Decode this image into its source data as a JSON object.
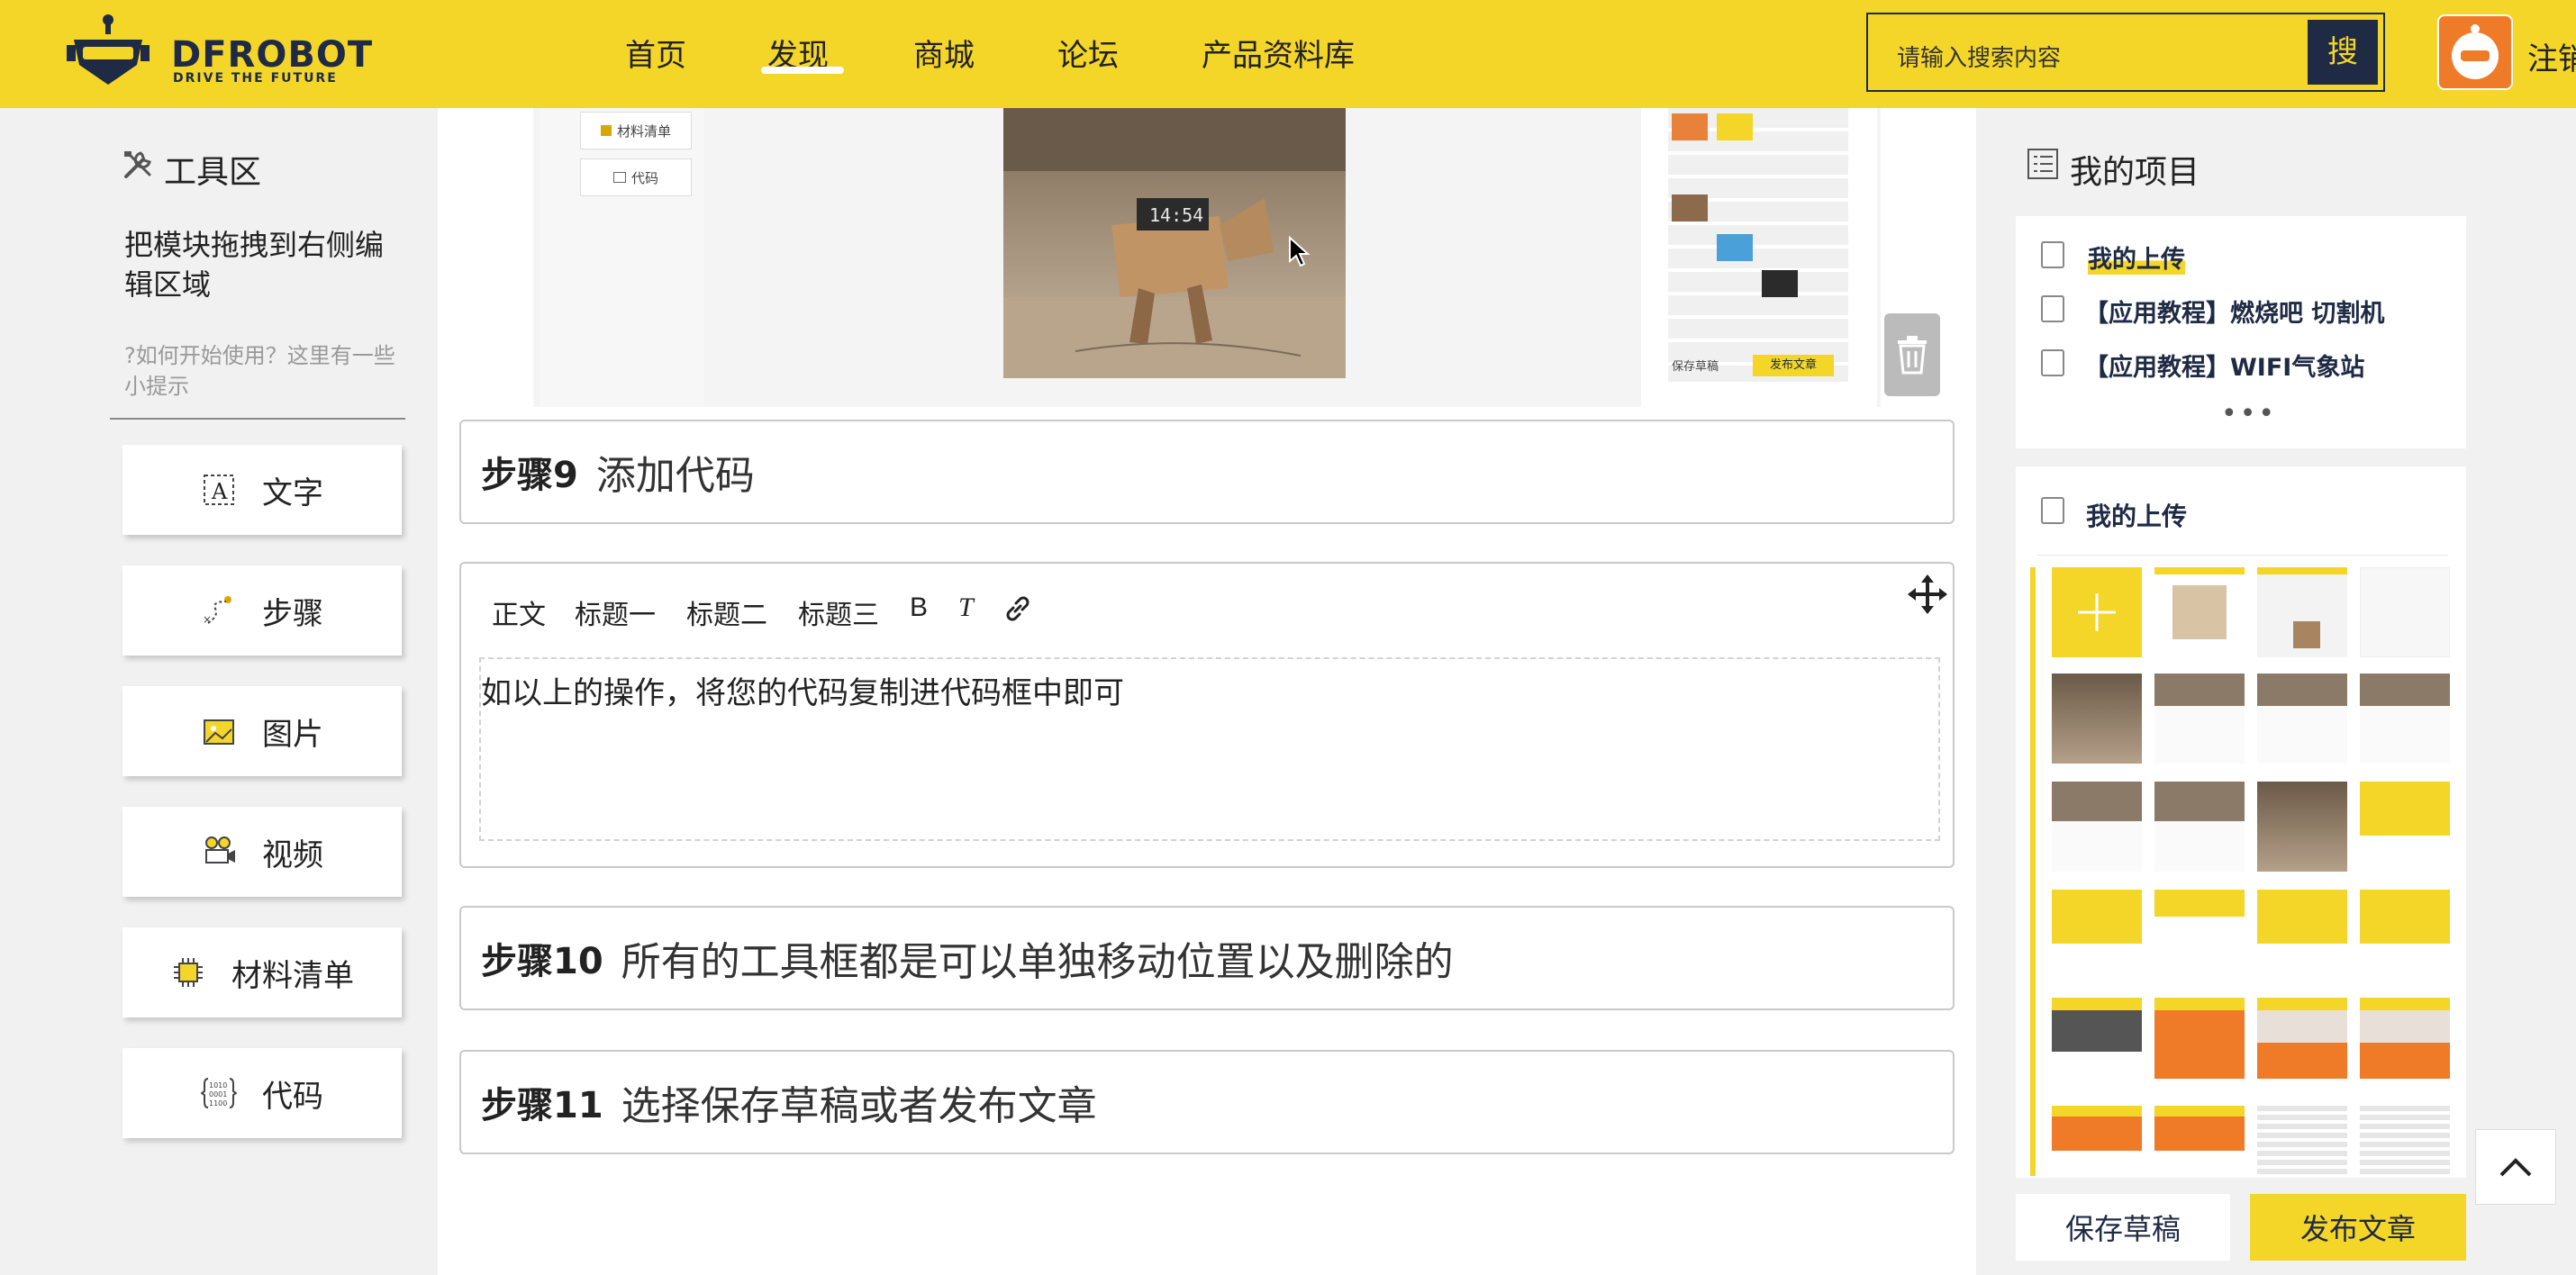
{
  "header": {
    "logo_text": "DFROBOT",
    "logo_tagline": "DRIVE THE FUTURE",
    "nav": [
      "首页",
      "发现",
      "商城",
      "论坛",
      "产品资料库"
    ],
    "active_nav": "发现",
    "search_placeholder": "请输入搜索内容",
    "search_button": "搜",
    "logout_label": "注销"
  },
  "left_panel": {
    "title": "工具区",
    "title_icon": "tools-icon",
    "drag_tip": "把模块拖拽到右侧编辑区域",
    "hint": "?如何开始使用？这里有一些小提示",
    "tools": [
      {
        "label": "文字",
        "icon": "text-icon"
      },
      {
        "label": "步骤",
        "icon": "steps-icon"
      },
      {
        "label": "图片",
        "icon": "image-icon"
      },
      {
        "label": "视频",
        "icon": "video-icon"
      },
      {
        "label": "材料清单",
        "icon": "chip-icon"
      },
      {
        "label": "代码",
        "icon": "code-icon"
      }
    ]
  },
  "preview": {
    "mini_buttons": [
      "材料清单",
      "代码"
    ],
    "clock_text": "14:54",
    "mini_save": "保存草稿",
    "mini_publish": "发布文章"
  },
  "steps": [
    {
      "tag": "步骤9",
      "text": "添加代码"
    },
    {
      "tag": "步骤10",
      "text": "所有的工具框都是可以单独移动位置以及删除的"
    },
    {
      "tag": "步骤11",
      "text": "选择保存草稿或者发布文章"
    }
  ],
  "editor": {
    "toolbar": [
      "正文",
      "标题一",
      "标题二",
      "标题三",
      "B",
      "T"
    ],
    "link_icon": "link-icon",
    "move_icon": "move-icon",
    "content": "如以上的操作，将您的代码复制进代码框中即可"
  },
  "right_panel": {
    "title": "我的项目",
    "title_icon": "list-icon",
    "items": [
      "我的上传",
      "【应用教程】燃烧吧 切割机",
      "【应用教程】WIFI气象站"
    ],
    "more": "•••",
    "uploads_title": "我的上传",
    "add_icon": "plus-icon",
    "save_draft": "保存草稿",
    "publish": "发布文章"
  },
  "colors": {
    "brand_yellow": "#f4d628",
    "navy": "#1f2a44",
    "orange": "#ef7b28"
  }
}
